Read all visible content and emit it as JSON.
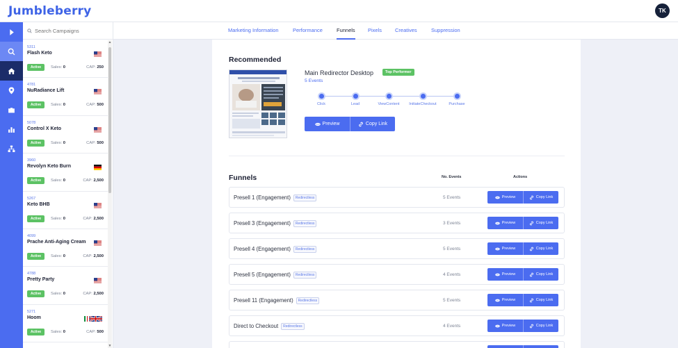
{
  "app": {
    "logo": "Jumbleberry",
    "avatar_initials": "TK"
  },
  "colors": {
    "brand": "#4b6cf0",
    "rail_active": "#1b2c69",
    "success": "#5cc264"
  },
  "rail": [
    "arrow-right-icon",
    "search-icon",
    "home-icon",
    "location-pin-icon",
    "briefcase-icon",
    "bar-chart-icon",
    "sitemap-icon"
  ],
  "search": {
    "placeholder": "Search Campaigns"
  },
  "campaigns": [
    {
      "id": "5311",
      "name": "Flash Keto",
      "status": "Active",
      "sales_label": "Sales:",
      "sales": "0",
      "cap_label": "CAP:",
      "cap": "250",
      "flag": "us-flag"
    },
    {
      "id": "4781",
      "name": "NuRadiance Lift",
      "status": "Active",
      "sales_label": "Sales:",
      "sales": "0",
      "cap_label": "CAP:",
      "cap": "500",
      "flag": "us-flag"
    },
    {
      "id": "5078",
      "name": "Control X Keto",
      "status": "Active",
      "sales_label": "Sales:",
      "sales": "0",
      "cap_label": "CAP:",
      "cap": "500",
      "flag": "us-flag"
    },
    {
      "id": "3960",
      "name": "Revolyn Keto Burn",
      "status": "Active",
      "sales_label": "Sales:",
      "sales": "0",
      "cap_label": "CAP:",
      "cap": "2,500",
      "flag": "de-flag"
    },
    {
      "id": "5267",
      "name": "Keto BHB",
      "status": "Active",
      "sales_label": "Sales:",
      "sales": "0",
      "cap_label": "CAP:",
      "cap": "2,500",
      "flag": "us-flag"
    },
    {
      "id": "4099",
      "name": "Prache Anti-Aging Cream",
      "status": "Active",
      "sales_label": "Sales:",
      "sales": "0",
      "cap_label": "CAP:",
      "cap": "2,500",
      "flag": "us-flag"
    },
    {
      "id": "4788",
      "name": "Pretty Party",
      "status": "Active",
      "sales_label": "Sales:",
      "sales": "0",
      "cap_label": "CAP:",
      "cap": "2,500",
      "flag": "us-flag"
    },
    {
      "id": "5271",
      "name": "Hoom",
      "status": "Active",
      "sales_label": "Sales:",
      "sales": "0",
      "cap_label": "CAP:",
      "cap": "500",
      "flag": "it-uk-flags"
    }
  ],
  "tabs": [
    "Marketing Information",
    "Performance",
    "Funnels",
    "Pixels",
    "Creatives",
    "Suppression"
  ],
  "active_tab": "Funnels",
  "recommended": {
    "heading": "Recommended",
    "title": "Main Redirector Desktop",
    "badge": "Top Performer",
    "events": "5 Events",
    "steps": [
      "Click",
      "Lead",
      "ViewContent",
      "InitiateCheckout",
      "Purchase"
    ],
    "preview_label": "Preview",
    "copy_label": "Copy Link"
  },
  "funnels": {
    "heading": "Funnels",
    "col_events": "No. Events",
    "col_actions": "Actions",
    "preview_label": "Preview",
    "copy_label": "Copy Link",
    "rows": [
      {
        "name": "Presell 1 (Engagement)",
        "tag": "Redirectless",
        "events": "5 Events"
      },
      {
        "name": "Presell 3 (Engagement)",
        "tag": "Redirectless",
        "events": "3 Events"
      },
      {
        "name": "Presell 4 (Engagement)",
        "tag": "Redirectless",
        "events": "5 Events"
      },
      {
        "name": "Presell 5 (Engagement)",
        "tag": "Redirectless",
        "events": "4 Events"
      },
      {
        "name": "Presell 11 (Engagement)",
        "tag": "Redirectless",
        "events": "5 Events"
      },
      {
        "name": "Direct to Checkout",
        "tag": "Redirectless",
        "events": "4 Events"
      }
    ]
  }
}
